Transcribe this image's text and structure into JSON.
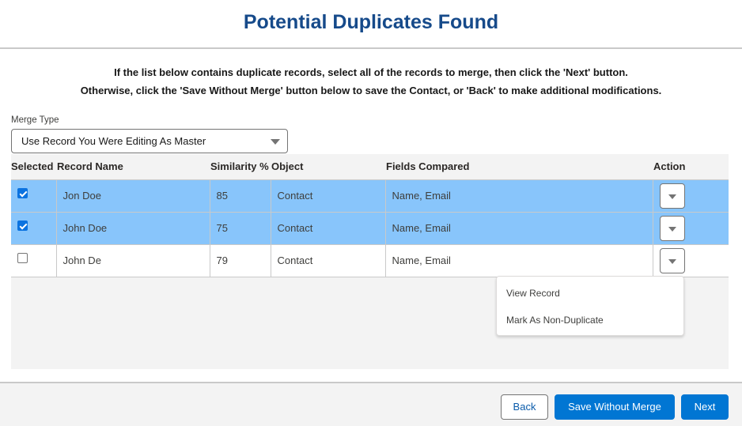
{
  "header": {
    "title": "Potential Duplicates Found"
  },
  "instructions": {
    "line1": "If the list below contains duplicate records, select all of the records to merge, then click the 'Next' button.",
    "line2": "Otherwise, click the 'Save Without Merge' button below to save the Contact, or 'Back' to make additional modifications."
  },
  "merge_type": {
    "label": "Merge Type",
    "selected": "Use Record You Were Editing As Master"
  },
  "table": {
    "columns": [
      "Selected",
      "Record Name",
      "Similarity %",
      "Object",
      "Fields Compared",
      "Action"
    ],
    "rows": [
      {
        "selected": true,
        "record_name": "Jon Doe",
        "similarity": "85",
        "object": "Contact",
        "fields_compared": "Name, Email"
      },
      {
        "selected": true,
        "record_name": "John Doe",
        "similarity": "75",
        "object": "Contact",
        "fields_compared": "Name, Email"
      },
      {
        "selected": false,
        "record_name": "John De",
        "similarity": "79",
        "object": "Contact",
        "fields_compared": "Name, Email"
      }
    ]
  },
  "action_menu": {
    "items": [
      "View Record",
      "Mark As Non-Duplicate"
    ]
  },
  "footer": {
    "back_label": "Back",
    "save_label": "Save Without Merge",
    "next_label": "Next"
  },
  "colors": {
    "title": "#164a8a",
    "selected_row": "#88c5fb",
    "brand_button": "#0176d3"
  }
}
